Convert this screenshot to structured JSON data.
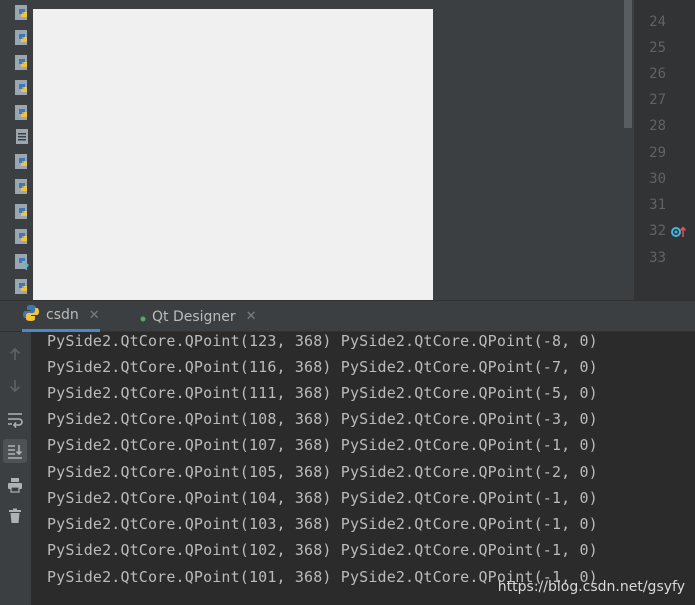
{
  "editor": {
    "line_numbers": [
      "24",
      "25",
      "26",
      "27",
      "28",
      "29",
      "30",
      "31",
      "32",
      "33"
    ]
  },
  "project_tree": {
    "files": [
      {
        "icon": "python-file-icon"
      },
      {
        "icon": "python-file-icon"
      },
      {
        "icon": "python-file-icon"
      },
      {
        "icon": "python-file-icon"
      },
      {
        "icon": "python-file-icon"
      },
      {
        "icon": "text-file-icon"
      },
      {
        "icon": "python-file-icon"
      },
      {
        "icon": "python-file-icon"
      },
      {
        "icon": "python-file-icon"
      },
      {
        "icon": "python-file-icon"
      },
      {
        "icon": "unknown-python-file-icon"
      },
      {
        "icon": "python-file-icon"
      }
    ]
  },
  "tabs": [
    {
      "label": "csdn",
      "icon": "python-icon"
    },
    {
      "label": "Qt Designer",
      "icon": "green-dot-icon"
    }
  ],
  "console": {
    "lines": [
      "PySide2.QtCore.QPoint(123, 368) PySide2.QtCore.QPoint(-8, 0)",
      "PySide2.QtCore.QPoint(116, 368) PySide2.QtCore.QPoint(-7, 0)",
      "PySide2.QtCore.QPoint(111, 368) PySide2.QtCore.QPoint(-5, 0)",
      "PySide2.QtCore.QPoint(108, 368) PySide2.QtCore.QPoint(-3, 0)",
      "PySide2.QtCore.QPoint(107, 368) PySide2.QtCore.QPoint(-1, 0)",
      "PySide2.QtCore.QPoint(105, 368) PySide2.QtCore.QPoint(-2, 0)",
      "PySide2.QtCore.QPoint(104, 368) PySide2.QtCore.QPoint(-1, 0)",
      "PySide2.QtCore.QPoint(103, 368) PySide2.QtCore.QPoint(-1, 0)",
      "PySide2.QtCore.QPoint(102, 368) PySide2.QtCore.QPoint(-1, 0)",
      "PySide2.QtCore.QPoint(101, 368) PySide2.QtCore.QPoint(-1, 0)"
    ]
  },
  "toolbar": {
    "buttons": [
      "up-arrow-icon",
      "down-arrow-icon",
      "soft-wrap-icon",
      "scroll-to-end-icon",
      "print-icon",
      "trash-icon"
    ]
  },
  "watermark": "https://blog.csdn.net/gsyfy",
  "colors": {
    "background": "#2b2b2b",
    "panel": "#3c3f41",
    "accent": "#4a88c7",
    "python_blue": "#3b78b5",
    "python_yellow": "#f3c33b"
  }
}
